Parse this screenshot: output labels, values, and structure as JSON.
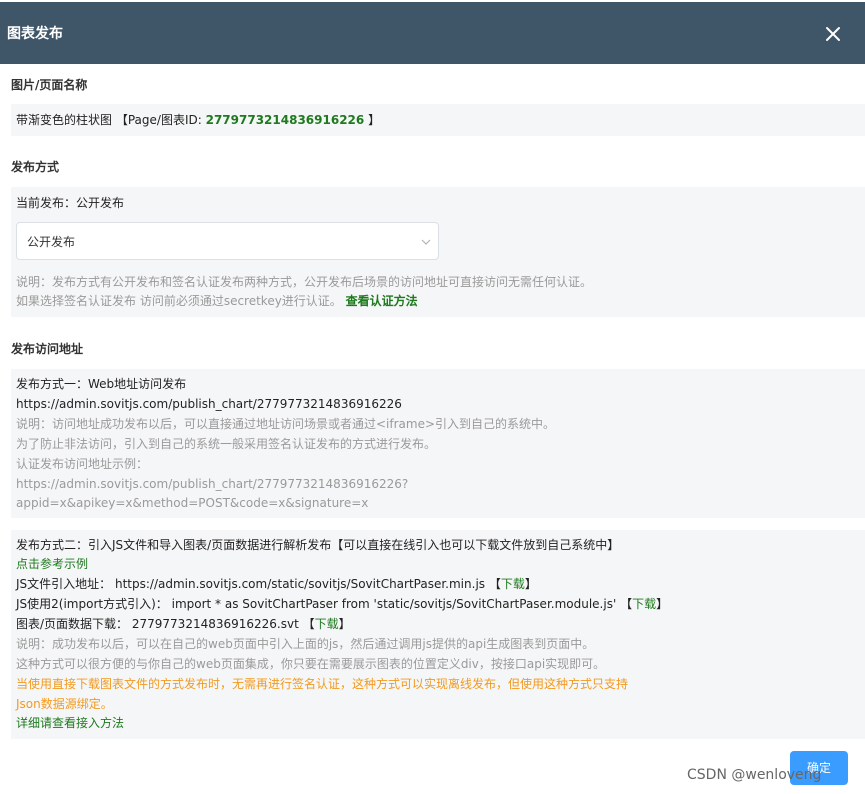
{
  "dialog": {
    "title": "图表发布"
  },
  "name_section": {
    "title": "图片/页面名称",
    "chart_name": "带渐变色的柱状图",
    "id_prefix": "【Page/图表ID:",
    "chart_id": "2779773214836916226",
    "id_suffix": "】"
  },
  "method_section": {
    "title": "发布方式",
    "current_label": "当前发布：公开发布",
    "select_value": "公开发布",
    "desc_1": "说明：发布方式有公开发布和签名认证发布两种方式，公开发布后场景的访问地址可直接访问无需任何认证。",
    "desc_2": "如果选择签名认证发布 访问前必须通过secretkey进行认证。",
    "auth_link": "查看认证方法"
  },
  "address_section": {
    "title": "发布访问地址",
    "web": {
      "heading": "发布方式一：Web地址访问发布",
      "url": "https://admin.sovitjs.com/publish_chart/2779773214836916226",
      "note_1": "说明：访问地址成功发布以后，可以直接通过地址访问场景或者通过<iframe>引入到自己的系统中。",
      "note_2": "为了防止非法访问，引入到自己的系统一般采用签名认证发布的方式进行发布。",
      "example_label": "认证发布访问地址示例：",
      "example_url": "https://admin.sovitjs.com/publish_chart/2779773214836916226?",
      "example_params": "appid=x&apikey=x&method=POST&code=x&signature=x"
    },
    "js": {
      "heading": "发布方式二：引入JS文件和导入图表/页面数据进行解析发布【可以直接在线引入也可以下载文件放到自己系统中】",
      "example_link": "点击参考示例",
      "js_url_label": "JS文件引入地址：",
      "js_url": "https://admin.sovitjs.com/static/sovitjs/SovitChartPaser.min.js",
      "import_label": "JS使用2(import方式引入)：",
      "import_code": "import * as SovitChartPaser from 'static/sovitjs/SovitChartPaser.module.js'",
      "data_label": "图表/页面数据下载：",
      "data_file": "2779773214836916226.svt",
      "bracket_open": "【",
      "download": "下载",
      "bracket_close": "】",
      "note_1": "说明：成功发布以后，可以在自己的web页面中引入上面的js，然后通过调用js提供的api生成图表到页面中。",
      "note_2": "这种方式可以很方便的与你自己的web页面集成，你只要在需要展示图表的位置定义div，按接口api实现即可。",
      "warn_1": "当使用直接下载图表文件的方式发布时，无需再进行签名认证，这种方式可以实现离线发布，但使用这种方式只支持",
      "warn_2": "Json数据源绑定。",
      "detail_link": "详细请查看接入方法"
    }
  },
  "footer": {
    "confirm_label": "确定",
    "watermark": "CSDN @wenloveng"
  },
  "colors": {
    "header": "#3f5568",
    "green_text": "#1f7a1f",
    "orange_text": "#f29a1f",
    "button": "#3a9cff"
  }
}
